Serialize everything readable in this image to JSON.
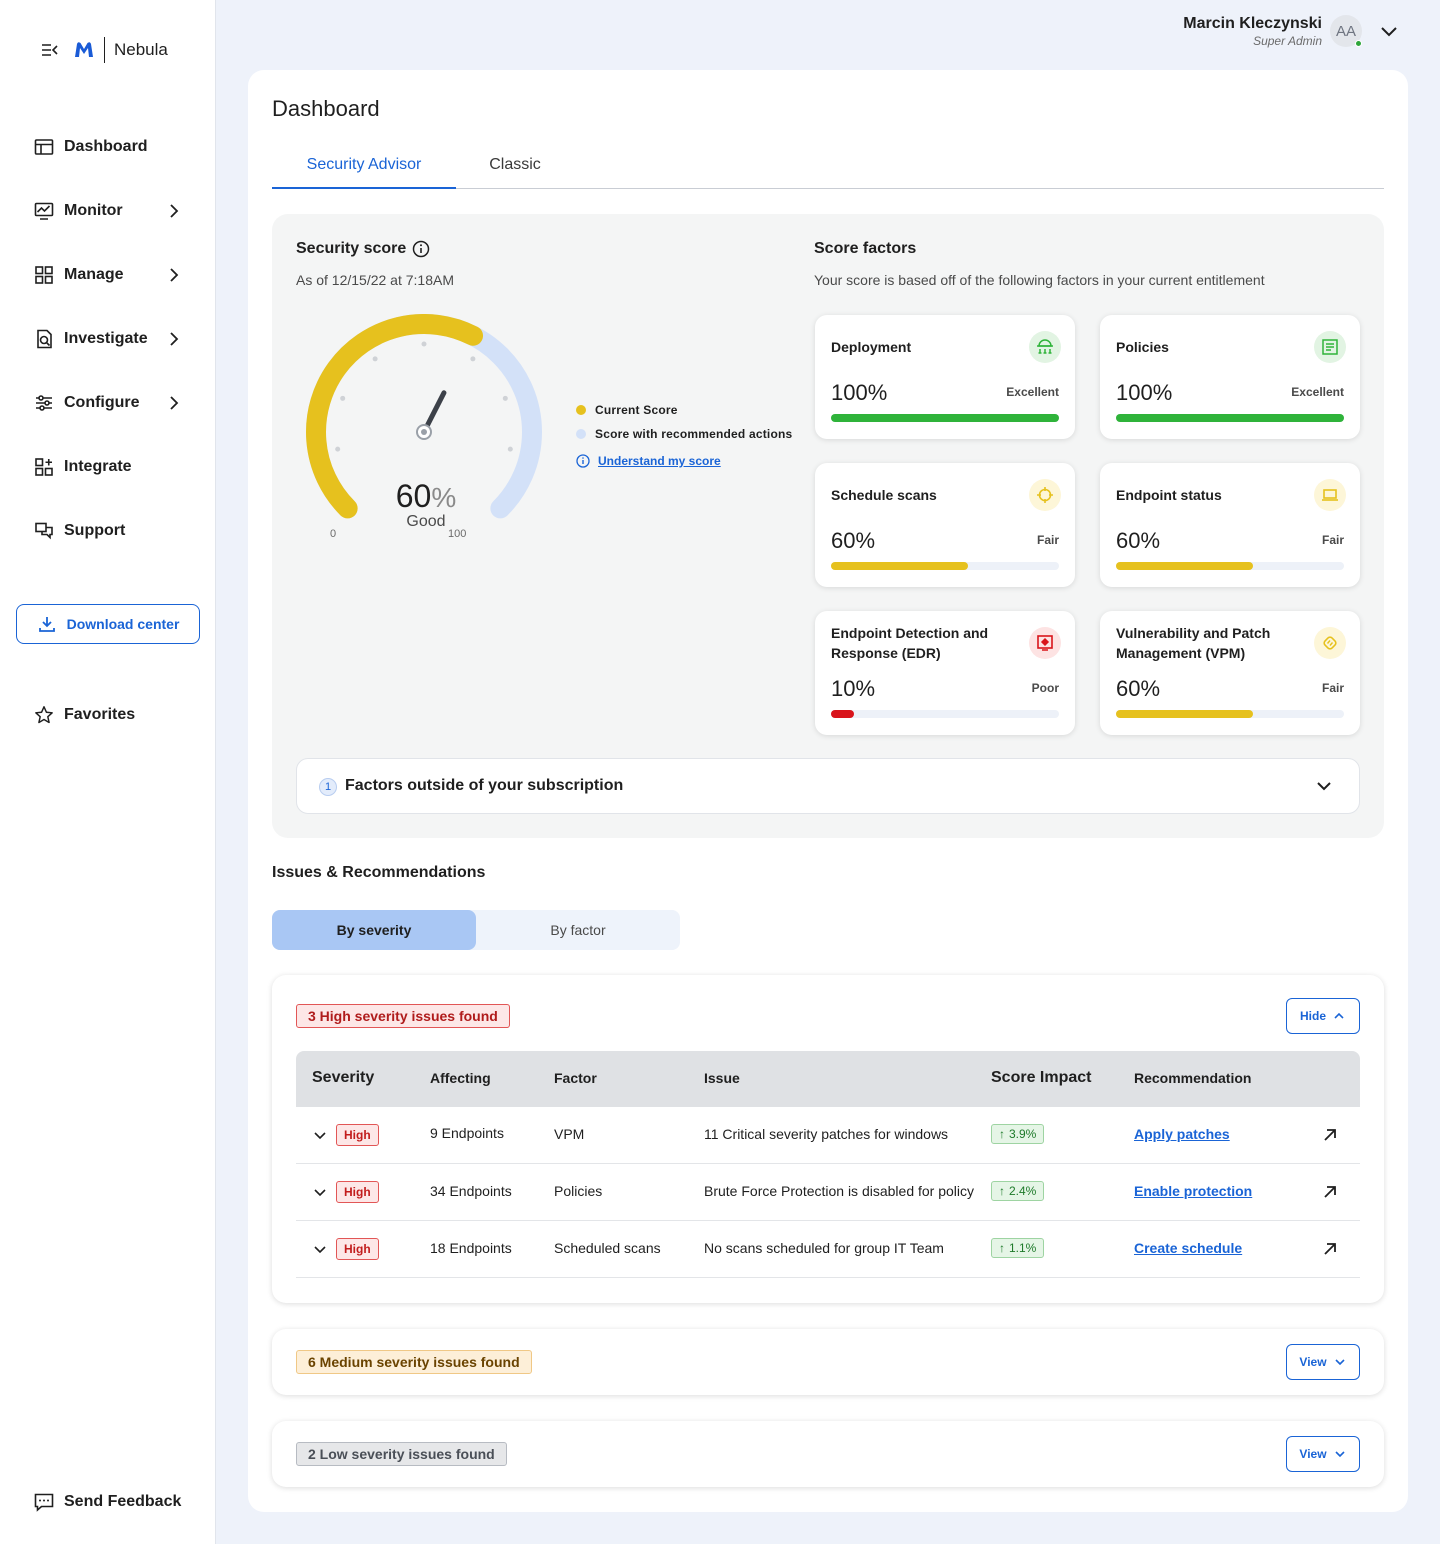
{
  "brand": {
    "name": "Nebula"
  },
  "sidebar": {
    "items": [
      {
        "label": "Dashboard"
      },
      {
        "label": "Monitor"
      },
      {
        "label": "Manage"
      },
      {
        "label": "Investigate"
      },
      {
        "label": "Configure"
      },
      {
        "label": "Integrate"
      },
      {
        "label": "Support"
      }
    ],
    "download_label": "Download center",
    "favorites_label": "Favorites",
    "feedback_label": "Send Feedback"
  },
  "user": {
    "name": "Marcin Kleczynski",
    "role": "Super Admin",
    "initials": "AA"
  },
  "page": {
    "title": "Dashboard",
    "tabs": [
      {
        "label": "Security Advisor"
      },
      {
        "label": "Classic"
      }
    ]
  },
  "security_score": {
    "title": "Security score",
    "as_of": "As of 12/15/22 at 7:18AM",
    "value": 60,
    "value_text": "60",
    "unit": "%",
    "rating": "Good",
    "recommended_value": 100,
    "min_label": "0",
    "max_label": "100",
    "legend_current": "Current Score",
    "legend_recommended": "Score with recommended actions",
    "understand_link": "Understand my score",
    "colors": {
      "current": "#e6c11e",
      "recommended": "#d3e1f8"
    }
  },
  "score_factors": {
    "title": "Score factors",
    "subtitle": "Your score is based off of the following factors in your current entitlement",
    "items": [
      {
        "name": "Deployment",
        "pct": "100%",
        "value": 100,
        "status": "Excellent",
        "color": "#2fb33a",
        "icon": "deployment-icon"
      },
      {
        "name": "Policies",
        "pct": "100%",
        "value": 100,
        "status": "Excellent",
        "color": "#2fb33a",
        "icon": "policies-icon"
      },
      {
        "name": "Schedule scans",
        "pct": "60%",
        "value": 60,
        "status": "Fair",
        "color": "#e6c11e",
        "icon": "crosshair-icon"
      },
      {
        "name": "Endpoint status",
        "pct": "60%",
        "value": 60,
        "status": "Fair",
        "color": "#e6c11e",
        "icon": "laptop-icon"
      },
      {
        "name": "Endpoint Detection and Response (EDR)",
        "pct": "10%",
        "value": 10,
        "status": "Poor",
        "color": "#d9141b",
        "icon": "edr-icon"
      },
      {
        "name": "Vulnerability and Patch Management (VPM)",
        "pct": "60%",
        "value": 60,
        "status": "Fair",
        "color": "#e6c11e",
        "icon": "patch-icon"
      }
    ],
    "outside": {
      "count": "1",
      "label": "Factors outside of your subscription"
    }
  },
  "issues": {
    "title": "Issues & Recommendations",
    "segments": [
      {
        "label": "By severity"
      },
      {
        "label": "By factor"
      }
    ],
    "high": {
      "tag": "3 High severity issues found",
      "button": "Hide",
      "columns": [
        "Severity",
        "Affecting",
        "Factor",
        "Issue",
        "Score Impact",
        "Recommendation"
      ],
      "rows": [
        {
          "severity": "High",
          "affecting": "9 Endpoints",
          "factor": "VPM",
          "issue": "11 Critical severity patches for windows",
          "impact": "3.9%",
          "recommendation": "Apply patches"
        },
        {
          "severity": "High",
          "affecting": "34 Endpoints",
          "factor": "Policies",
          "issue": "Brute Force Protection is disabled for policy",
          "impact": "2.4%",
          "recommendation": "Enable protection"
        },
        {
          "severity": "High",
          "affecting": "18 Endpoints",
          "factor": "Scheduled scans",
          "issue": "No scans scheduled for group IT Team",
          "impact": "1.1%",
          "recommendation": "Create schedule"
        }
      ]
    },
    "medium": {
      "tag": "6 Medium severity issues found",
      "button": "View"
    },
    "low": {
      "tag": "2 Low severity issues found",
      "button": "View"
    }
  }
}
